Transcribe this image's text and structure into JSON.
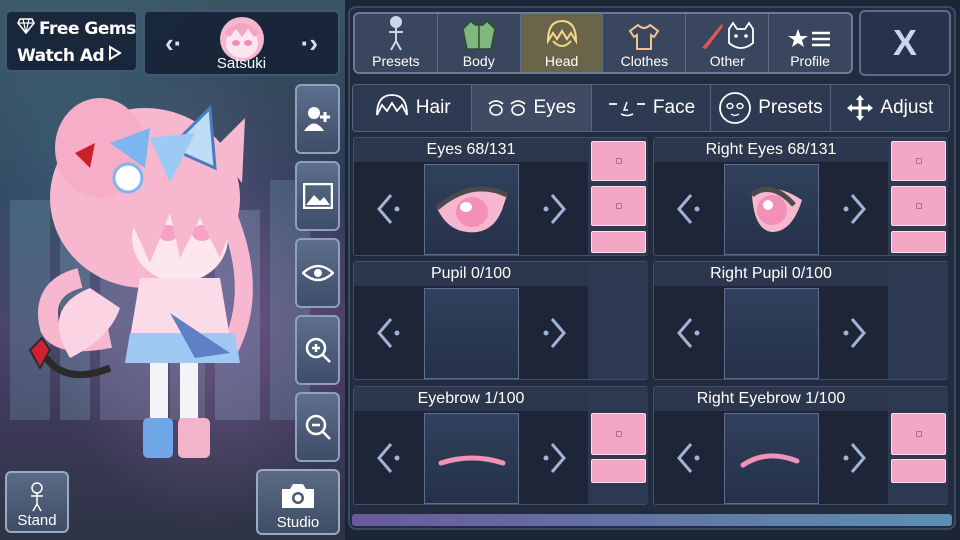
{
  "header": {
    "free_gems_label": "Free Gems",
    "watch_ad_label": "Watch Ad",
    "character_name": "Satsuki"
  },
  "left_buttons": {
    "stand_label": "Stand",
    "studio_label": "Studio"
  },
  "categories": [
    {
      "label": "Presets",
      "icon": "person-icon",
      "active": false
    },
    {
      "label": "Body",
      "icon": "jacket-icon",
      "active": false
    },
    {
      "label": "Head",
      "icon": "hair-icon",
      "active": true
    },
    {
      "label": "Clothes",
      "icon": "shirt-icon",
      "active": false
    },
    {
      "label": "Other",
      "icon": "sword-cat-icon",
      "active": false
    },
    {
      "label": "Profile",
      "icon": "star-list-icon",
      "active": false
    }
  ],
  "close_label": "X",
  "sub_tabs": [
    {
      "label": "Hair",
      "icon": "hair-icon",
      "active": false
    },
    {
      "label": "Eyes",
      "icon": "eyes-icon",
      "active": true
    },
    {
      "label": "Face",
      "icon": "face-icon",
      "active": false
    },
    {
      "label": "Presets",
      "icon": "face-preset-icon",
      "active": false
    },
    {
      "label": "Adjust",
      "icon": "move-icon",
      "active": false
    }
  ],
  "slots": [
    {
      "title": "Eyes 68/131",
      "swatches": 3
    },
    {
      "title": "Right Eyes 68/131",
      "swatches": 3
    },
    {
      "title": "Pupil 0/100",
      "swatches": 0
    },
    {
      "title": "Right Pupil 0/100",
      "swatches": 0
    },
    {
      "title": "Eyebrow 1/100",
      "swatches": 2
    },
    {
      "title": "Right Eyebrow 1/100",
      "swatches": 2
    }
  ],
  "colors": {
    "swatch_pink": "#f4a7c4",
    "active_category": "#6a6548",
    "panel_bg": "#222c3f"
  }
}
